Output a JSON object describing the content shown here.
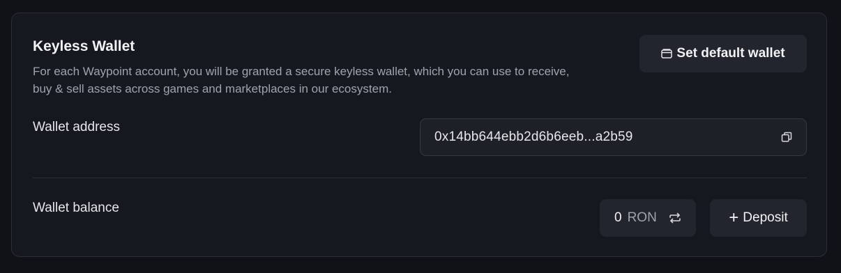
{
  "wallet": {
    "title": "Keyless Wallet",
    "description": "For each Waypoint account, you will be granted a secure keyless wallet, which you can use to receive, buy & sell assets across games and marketplaces in our ecosystem.",
    "set_default_label": "Set default wallet",
    "set_default_icon": "wallet-icon"
  },
  "address_row": {
    "label": "Wallet address",
    "value": "0x14bb644ebb2d6b6eeb...a2b59",
    "copy_icon": "copy-icon"
  },
  "balance_row": {
    "label": "Wallet balance",
    "amount": "0",
    "unit": "RON",
    "swap_icon": "swap-icon",
    "deposit_label": "Deposit",
    "deposit_icon": "plus-icon"
  },
  "colors": {
    "background": "#111217",
    "card": "#161820",
    "button": "#22252d",
    "text_primary": "#f1f2f4",
    "text_secondary": "#9ea3ae"
  }
}
